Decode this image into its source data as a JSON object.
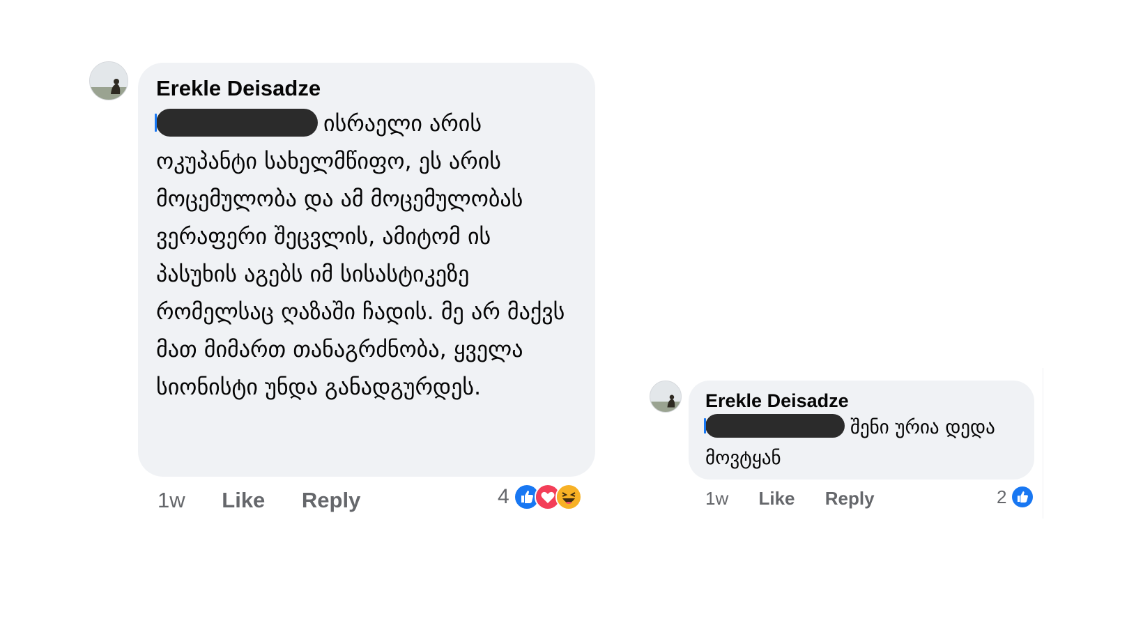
{
  "comments": [
    {
      "author": "Erekle Deisadze",
      "text": "ისრაელი არის ოკუპანტი სახელმწიფო, ეს არის მოცემულობა და ამ მოცემულობას ვერაფერი შეცვლის, ამიტომ ის პასუხის აგებს იმ სისასტიკეზე რომელსაც ღაზაში ჩადის. მე არ მაქვს მათ მიმართ თანაგრძნობა, ყველა სიონისტი უნდა განადგურდეს.",
      "time": "1w",
      "like_label": "Like",
      "reply_label": "Reply",
      "reaction_count": "4",
      "reactions": [
        "like-icon",
        "love-icon",
        "haha-icon"
      ]
    },
    {
      "author": "Erekle Deisadze",
      "text": "შენი ურია დედა მოვტყან",
      "time": "1w",
      "like_label": "Like",
      "reply_label": "Reply",
      "reaction_count": "2",
      "reactions": [
        "like-icon"
      ]
    }
  ],
  "colors": {
    "bubble_bg": "#f0f2f5",
    "like_blue": "#1877f2",
    "love_red": "#f33e58",
    "haha_yellow": "#f7b125",
    "action_gray": "#65676b"
  }
}
